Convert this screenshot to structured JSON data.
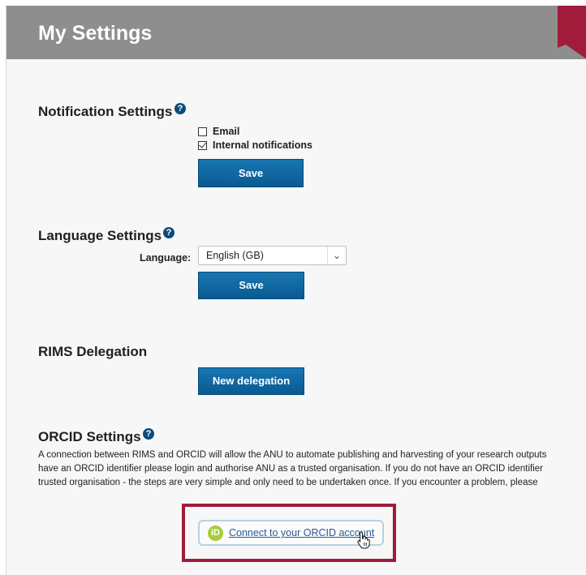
{
  "header": {
    "title": "My Settings"
  },
  "notification": {
    "title": "Notification Settings",
    "help": "?",
    "options": [
      {
        "label": "Email",
        "checked": false
      },
      {
        "label": "Internal notifications",
        "checked": true
      }
    ],
    "save_label": "Save"
  },
  "language": {
    "title": "Language Settings",
    "help": "?",
    "field_label": "Language:",
    "selected": "English (GB)",
    "arrow": "⌄",
    "save_label": "Save"
  },
  "delegation": {
    "title": "RIMS Delegation",
    "button_label": "New delegation"
  },
  "orcid": {
    "title": "ORCID Settings",
    "help": "?",
    "description_lines": [
      "A connection between RIMS and ORCID will allow the ANU to automate publishing and harvesting of your research outputs",
      "have an ORCID identifier please login and authorise ANU as a trusted organisation. If you do not have an ORCID identifier",
      "trusted organisation - the steps are very simple and only need to be undertaken once. If you encounter a problem, please"
    ],
    "logo_text": "iD",
    "connect_label": "Connect to your ORCID account",
    "highlight_color": "#a11c3a",
    "logo_color": "#a6ce39"
  },
  "colors": {
    "header_bg": "#8e8e8e",
    "button_bg": "#0a5a92",
    "accent_corner": "#a11c3a"
  }
}
